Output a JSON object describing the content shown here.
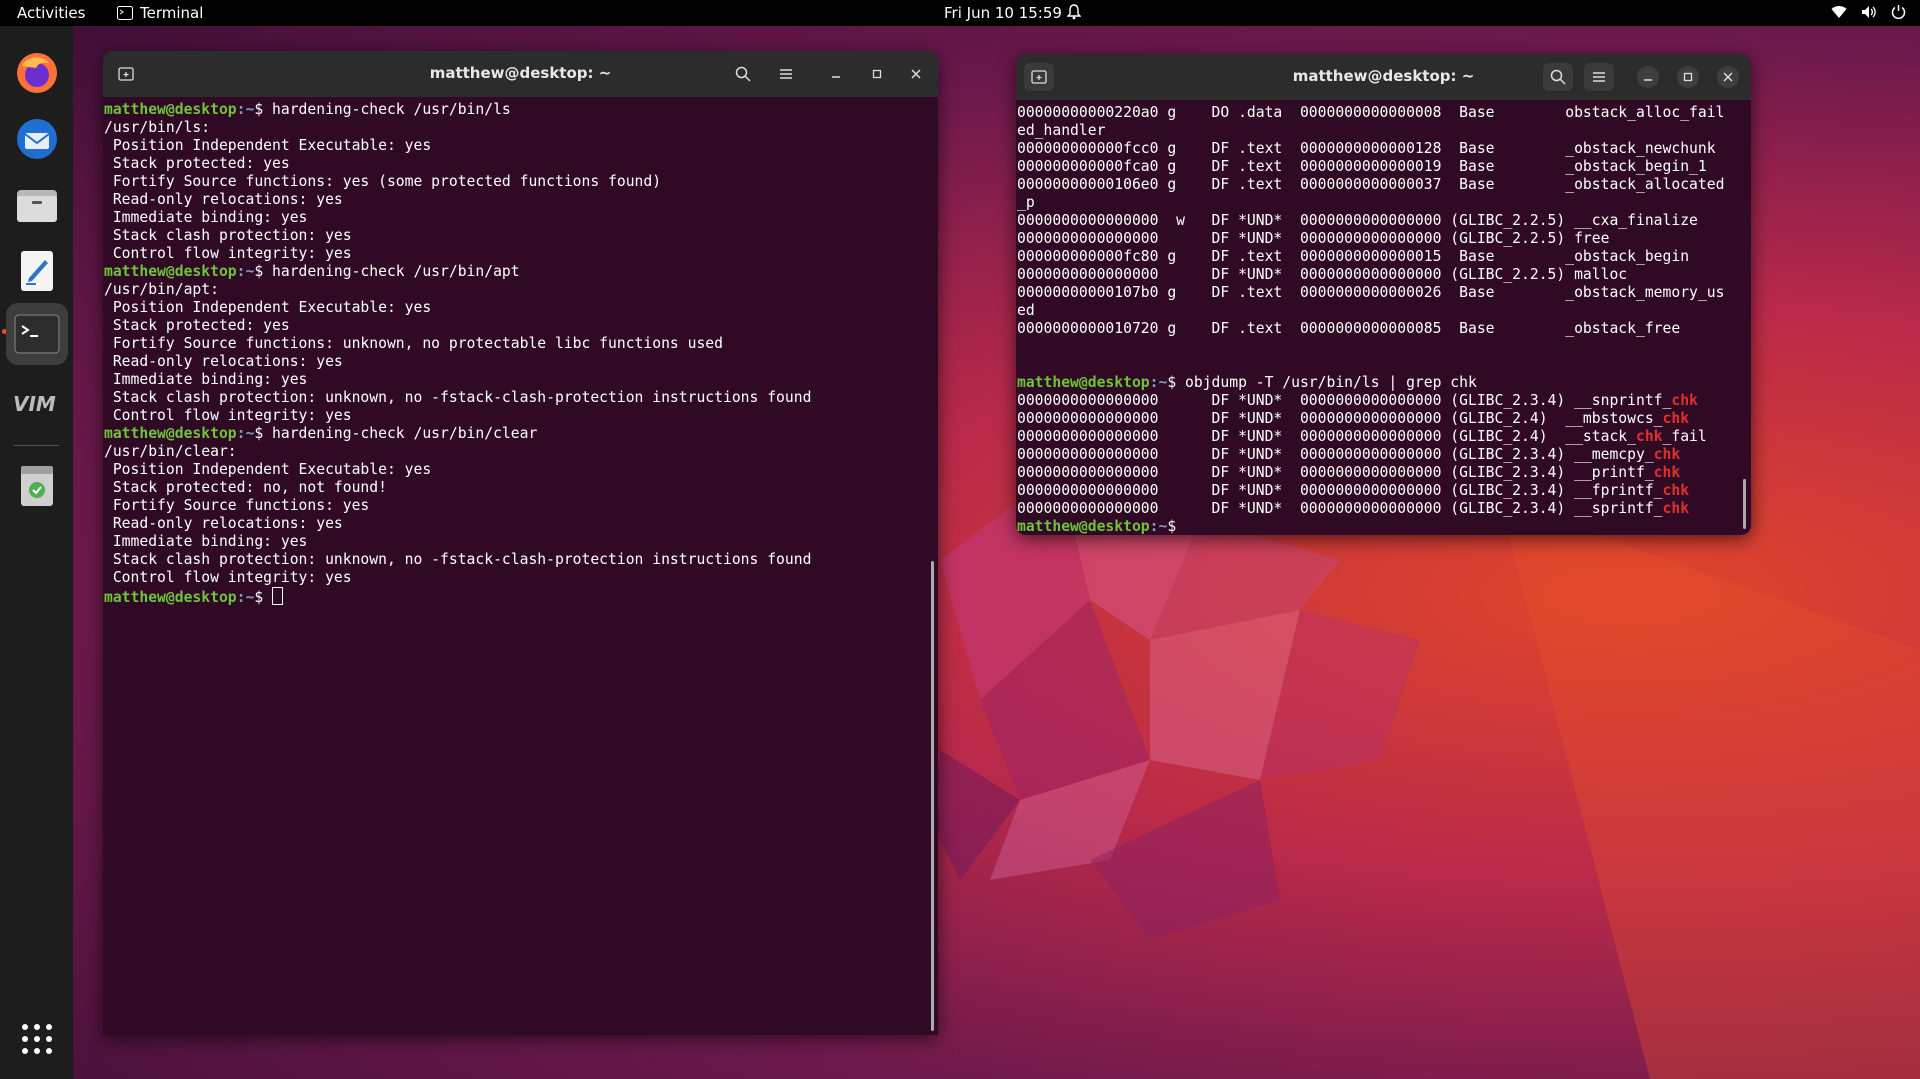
{
  "topbar": {
    "activities": "Activities",
    "app_name": "Terminal",
    "clock": "Fri Jun 10  15:59"
  },
  "dock": {
    "items": [
      {
        "icon": "firefox-icon"
      },
      {
        "icon": "thunderbird-icon"
      },
      {
        "icon": "files-icon"
      },
      {
        "icon": "text-editor-icon"
      },
      {
        "icon": "terminal-icon",
        "active": true
      },
      {
        "icon": "vim-icon"
      },
      {
        "icon": "trash-icon"
      },
      {
        "icon": "show-apps-icon"
      }
    ]
  },
  "window_left": {
    "title": "matthew@desktop: ~",
    "prompt_user": "matthew@desktop",
    "prompt_path": ":~",
    "lines": [
      {
        "type": "cmd",
        "cmd": "hardening-check /usr/bin/ls"
      },
      {
        "type": "out",
        "text": "/usr/bin/ls:"
      },
      {
        "type": "out",
        "text": " Position Independent Executable: yes"
      },
      {
        "type": "out",
        "text": " Stack protected: yes"
      },
      {
        "type": "out",
        "text": " Fortify Source functions: yes (some protected functions found)"
      },
      {
        "type": "out",
        "text": " Read-only relocations: yes"
      },
      {
        "type": "out",
        "text": " Immediate binding: yes"
      },
      {
        "type": "out",
        "text": " Stack clash protection: yes"
      },
      {
        "type": "out",
        "text": " Control flow integrity: yes"
      },
      {
        "type": "cmd",
        "cmd": "hardening-check /usr/bin/apt"
      },
      {
        "type": "out",
        "text": "/usr/bin/apt:"
      },
      {
        "type": "out",
        "text": " Position Independent Executable: yes"
      },
      {
        "type": "out",
        "text": " Stack protected: yes"
      },
      {
        "type": "out",
        "text": " Fortify Source functions: unknown, no protectable libc functions used"
      },
      {
        "type": "out",
        "text": " Read-only relocations: yes"
      },
      {
        "type": "out",
        "text": " Immediate binding: yes"
      },
      {
        "type": "out",
        "text": " Stack clash protection: unknown, no -fstack-clash-protection instructions found"
      },
      {
        "type": "out",
        "text": " Control flow integrity: yes"
      },
      {
        "type": "cmd",
        "cmd": "hardening-check /usr/bin/clear"
      },
      {
        "type": "out",
        "text": "/usr/bin/clear:"
      },
      {
        "type": "out",
        "text": " Position Independent Executable: yes"
      },
      {
        "type": "out",
        "text": " Stack protected: no, not found!"
      },
      {
        "type": "out",
        "text": " Fortify Source functions: yes"
      },
      {
        "type": "out",
        "text": " Read-only relocations: yes"
      },
      {
        "type": "out",
        "text": " Immediate binding: yes"
      },
      {
        "type": "out",
        "text": " Stack clash protection: unknown, no -fstack-clash-protection instructions found"
      },
      {
        "type": "out",
        "text": " Control flow integrity: yes"
      },
      {
        "type": "prompt",
        "cursor": true
      }
    ]
  },
  "window_right": {
    "title": "matthew@desktop: ~",
    "prompt_user": "matthew@desktop",
    "prompt_path": ":~",
    "lines": [
      {
        "type": "out",
        "text": "00000000000220a0 g    DO .data  0000000000000008  Base        obstack_alloc_fail"
      },
      {
        "type": "out",
        "text": "ed_handler"
      },
      {
        "type": "out",
        "text": "000000000000fcc0 g    DF .text  0000000000000128  Base        _obstack_newchunk"
      },
      {
        "type": "out",
        "text": "000000000000fca0 g    DF .text  0000000000000019  Base        _obstack_begin_1"
      },
      {
        "type": "out",
        "text": "00000000000106e0 g    DF .text  0000000000000037  Base        _obstack_allocated"
      },
      {
        "type": "out",
        "text": "_p"
      },
      {
        "type": "out",
        "text": "0000000000000000  w   DF *UND*  0000000000000000 (GLIBC_2.2.5) __cxa_finalize"
      },
      {
        "type": "out",
        "text": "0000000000000000      DF *UND*  0000000000000000 (GLIBC_2.2.5) free"
      },
      {
        "type": "out",
        "text": "000000000000fc80 g    DF .text  0000000000000015  Base        _obstack_begin"
      },
      {
        "type": "out",
        "text": "0000000000000000      DF *UND*  0000000000000000 (GLIBC_2.2.5) malloc"
      },
      {
        "type": "out",
        "text": "00000000000107b0 g    DF .text  0000000000000026  Base        _obstack_memory_us"
      },
      {
        "type": "out",
        "text": "ed"
      },
      {
        "type": "out",
        "text": "0000000000010720 g    DF .text  0000000000000085  Base        _obstack_free"
      },
      {
        "type": "out",
        "text": ""
      },
      {
        "type": "out",
        "text": ""
      },
      {
        "type": "cmd",
        "cmd": "objdump -T /usr/bin/ls | grep chk"
      },
      {
        "type": "grep",
        "pre": "0000000000000000      DF *UND*  0000000000000000 (GLIBC_2.3.4) __snprintf_",
        "match": "chk",
        "post": ""
      },
      {
        "type": "grep",
        "pre": "0000000000000000      DF *UND*  0000000000000000 (GLIBC_2.4)  __mbstowcs_",
        "match": "chk",
        "post": ""
      },
      {
        "type": "grep",
        "pre": "0000000000000000      DF *UND*  0000000000000000 (GLIBC_2.4)  __stack_",
        "match": "chk",
        "post": "_fail"
      },
      {
        "type": "grep",
        "pre": "0000000000000000      DF *UND*  0000000000000000 (GLIBC_2.3.4) __memcpy_",
        "match": "chk",
        "post": ""
      },
      {
        "type": "grep",
        "pre": "0000000000000000      DF *UND*  0000000000000000 (GLIBC_2.3.4) __printf_",
        "match": "chk",
        "post": ""
      },
      {
        "type": "grep",
        "pre": "0000000000000000      DF *UND*  0000000000000000 (GLIBC_2.3.4) __fprintf_",
        "match": "chk",
        "post": ""
      },
      {
        "type": "grep",
        "pre": "0000000000000000      DF *UND*  0000000000000000 (GLIBC_2.3.4) __sprintf_",
        "match": "chk",
        "post": ""
      },
      {
        "type": "prompt",
        "cursor": false
      }
    ]
  }
}
